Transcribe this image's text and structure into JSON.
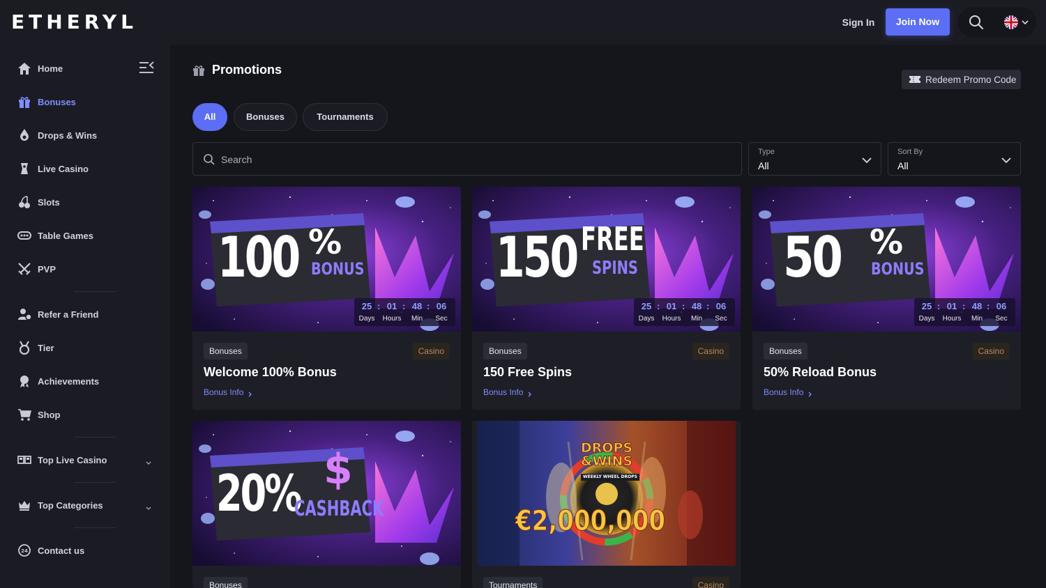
{
  "header": {
    "logo": "ETHERYL",
    "sign_in": "Sign In",
    "join_now": "Join Now",
    "search_icon": "search-icon",
    "language_icon": "uk-flag-icon"
  },
  "sidebar": {
    "items": [
      {
        "label": "Home",
        "icon": "home-icon"
      },
      {
        "label": "Bonuses",
        "icon": "gift-icon",
        "active": true
      },
      {
        "label": "Drops & Wins",
        "icon": "drops-wins-icon"
      },
      {
        "label": "Live Casino",
        "icon": "live-casino-icon"
      },
      {
        "label": "Slots",
        "icon": "cherries-icon"
      },
      {
        "label": "Table Games",
        "icon": "table-games-icon"
      },
      {
        "label": "PVP",
        "icon": "swords-icon"
      },
      {
        "label": "Refer a Friend",
        "icon": "refer-friend-icon"
      },
      {
        "label": "Tier",
        "icon": "medal-icon"
      },
      {
        "label": "Achievements",
        "icon": "achievement-icon"
      },
      {
        "label": "Shop",
        "icon": "cart-icon"
      },
      {
        "label": "Top Live Casino",
        "icon": "live-grid-icon",
        "expandable": true
      },
      {
        "label": "Top Categories",
        "icon": "crown-icon",
        "expandable": true
      },
      {
        "label": "Contact us",
        "icon": "support-24-icon"
      }
    ]
  },
  "main": {
    "title": "Promotions",
    "redeem": "Redeem Promo Code",
    "tabs": [
      {
        "label": "All",
        "active": true
      },
      {
        "label": "Bonuses"
      },
      {
        "label": "Tournaments"
      }
    ],
    "search": {
      "placeholder": "Search",
      "value": ""
    },
    "filters": {
      "type": {
        "label": "Type",
        "value": "All"
      },
      "sort": {
        "label": "Sort By",
        "value": "All"
      }
    },
    "timer_labels": {
      "days": "Days",
      "hours": "Hours",
      "min": "Min",
      "sec": "Sec"
    },
    "cards": [
      {
        "title": "Welcome 100% Bonus",
        "type": "Bonuses",
        "category": "Casino",
        "link": "Bonus Info",
        "banner": {
          "big": "100",
          "small": "%",
          "sub": "BONUS"
        },
        "timer": {
          "days": "25",
          "hours": "01",
          "min": "48",
          "sec": "06"
        }
      },
      {
        "title": "150 Free Spins",
        "type": "Bonuses",
        "category": "Casino",
        "link": "Bonus Info",
        "banner": {
          "big": "150",
          "small": "FREE",
          "sub": "SPINS"
        },
        "timer": {
          "days": "25",
          "hours": "01",
          "min": "48",
          "sec": "06"
        }
      },
      {
        "title": "50% Reload Bonus",
        "type": "Bonuses",
        "category": "Casino",
        "link": "Bonus Info",
        "banner": {
          "big": "50",
          "small": "%",
          "sub": "BONUS"
        },
        "timer": {
          "days": "25",
          "hours": "01",
          "min": "48",
          "sec": "06"
        }
      },
      {
        "type": "Bonuses",
        "banner": {
          "big": "20%",
          "small": "$",
          "sub": "CASHBACK"
        }
      },
      {
        "type": "Tournaments",
        "category": "Casino",
        "banner": {
          "headline": "DROPS &WINS",
          "amount": "€2,000,000",
          "tag": "WEEKLY WHEEL DROPS"
        }
      }
    ]
  },
  "colors": {
    "accent": "#5b6ef5",
    "link": "#7f8dff",
    "background": "#15161b",
    "panel": "#1b1c23",
    "casino_badge_text": "#b58a5c"
  }
}
